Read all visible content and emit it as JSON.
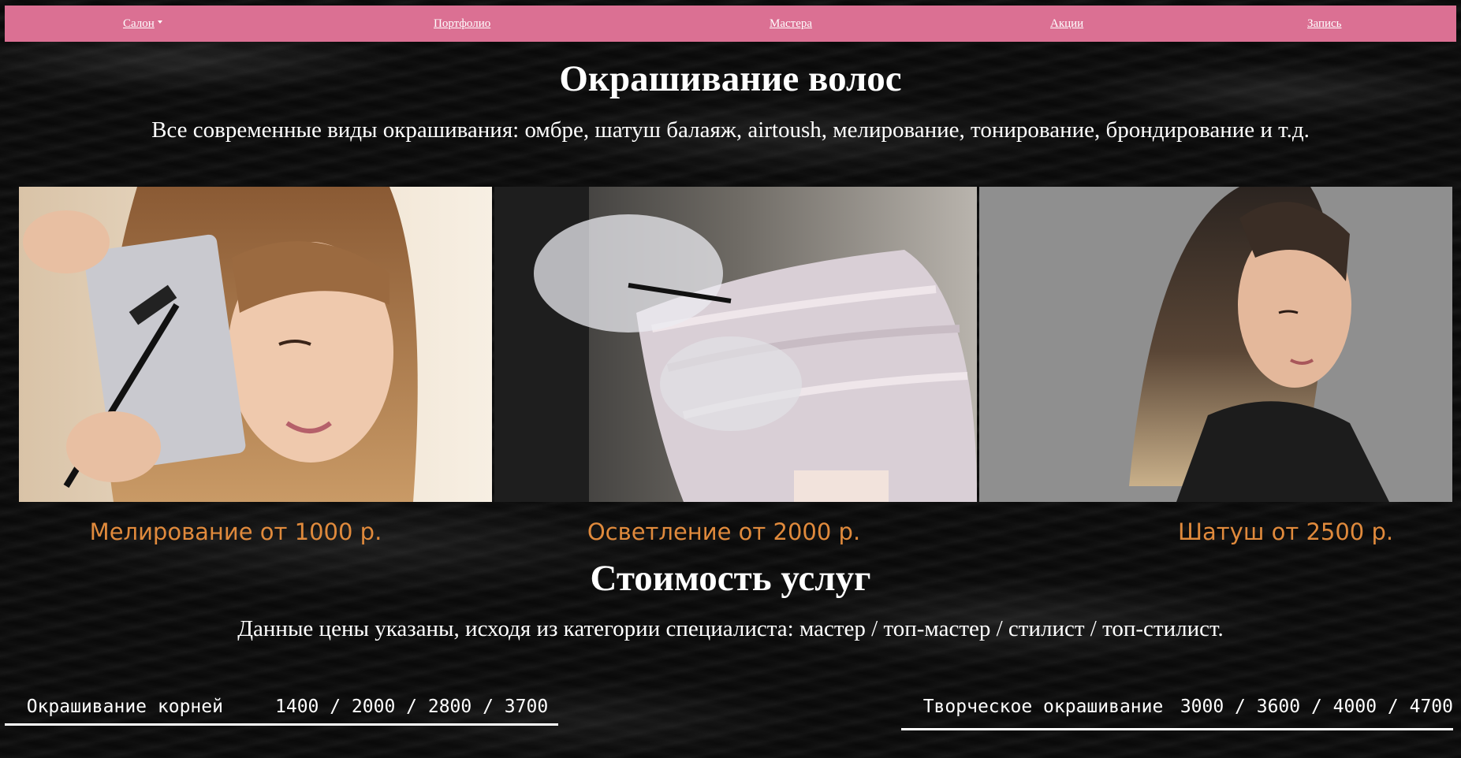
{
  "nav": {
    "items": [
      {
        "label": "Салон",
        "has_dropdown": true
      },
      {
        "label": "Портфолио"
      },
      {
        "label": "Мастера"
      },
      {
        "label": "Акции"
      },
      {
        "label": "Запись"
      }
    ]
  },
  "hero": {
    "title": "Окрашивание волос",
    "subtitle": "Все современные виды окрашивания: омбре, шатуш балаяж, airtoush, мелирование, тонирование, брондирование и т.д."
  },
  "services": [
    {
      "caption": "Мелирование от 1000 р."
    },
    {
      "caption": "Осветление от 2000 р."
    },
    {
      "caption": "Шатуш от 2500 р."
    }
  ],
  "pricing": {
    "title": "Стоимость услуг",
    "subtitle": "Данные цены указаны, исходя из категории специалиста: мастер / топ-мастер / стилист / топ-стилист.",
    "rows": [
      {
        "name": "Окрашивание корней",
        "prices": "1400 / 2000 / 2800 / 3700"
      },
      {
        "name": "Творческое окрашивание",
        "prices": "3000 / 3600 / 4000 / 4700"
      }
    ]
  },
  "colors": {
    "navbar": "#db7093",
    "caption": "#e08a3c",
    "text": "#ffffff",
    "background": "#0b0b0b"
  }
}
